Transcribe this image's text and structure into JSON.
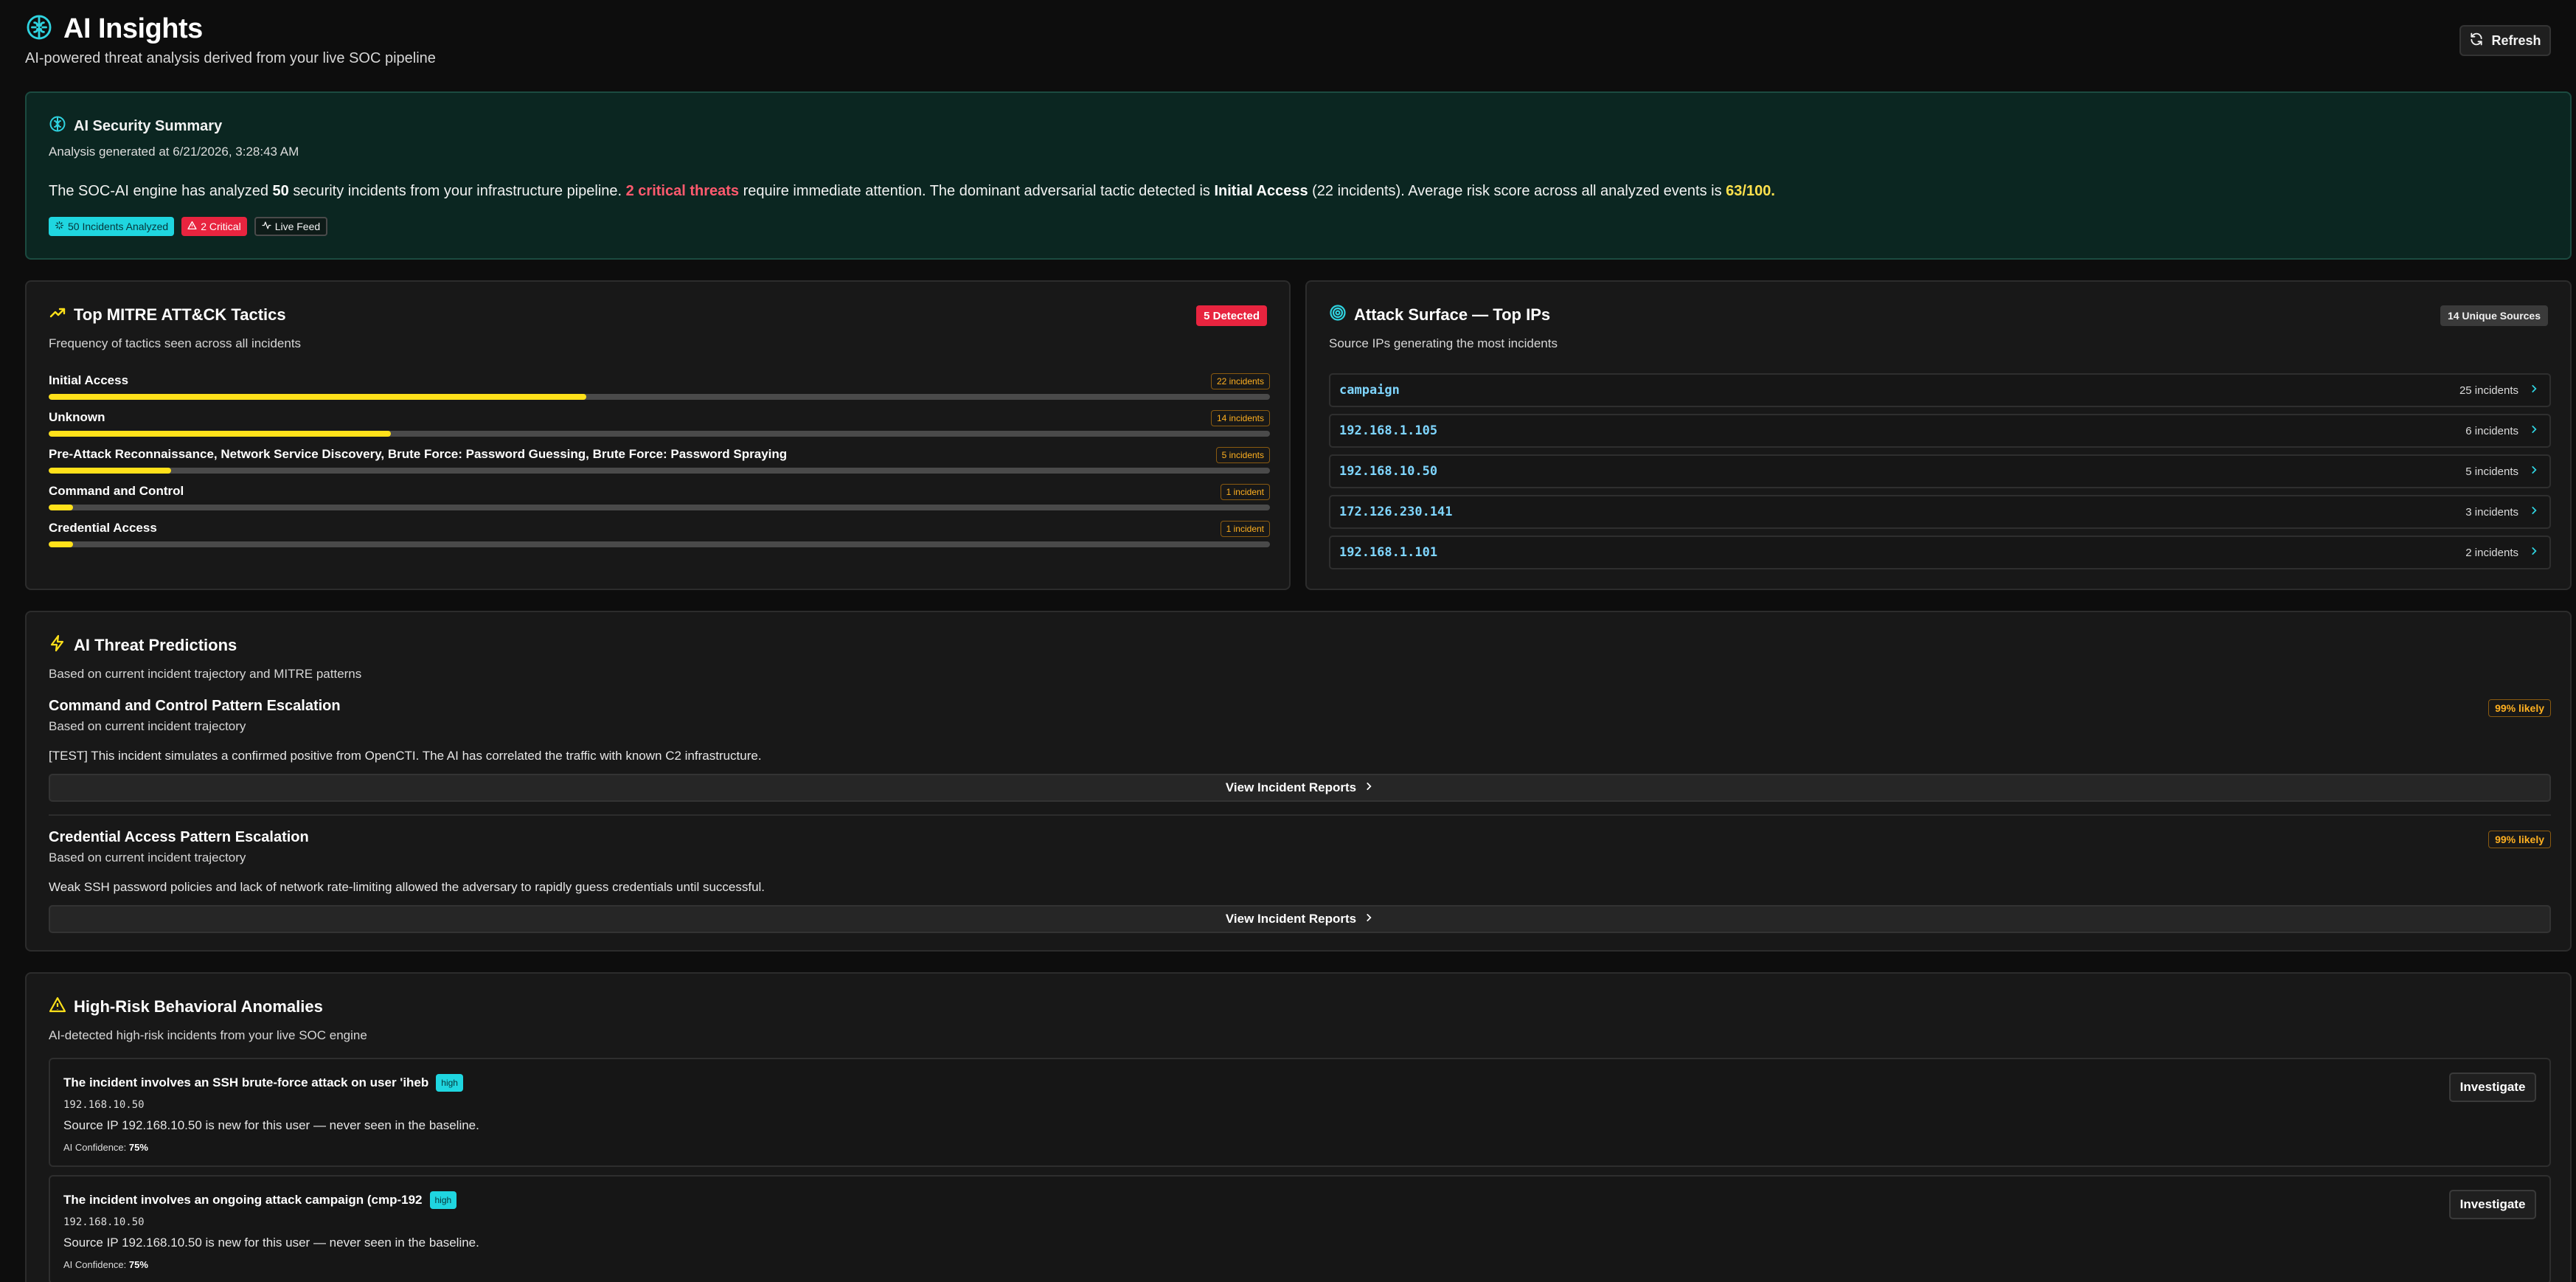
{
  "header": {
    "title": "AI Insights",
    "subtitle": "AI-powered threat analysis derived from your live SOC pipeline",
    "refresh_label": "Refresh"
  },
  "summary": {
    "title": "AI Security Summary",
    "generated": "Analysis generated at 6/21/2026, 3:28:43 AM",
    "text_1": "The SOC-AI engine has analyzed ",
    "incident_count": "50",
    "text_2": " security incidents from your infrastructure pipeline. ",
    "critical_text": "2 critical threats",
    "text_3": " require immediate attention. The dominant adversarial tactic detected is ",
    "dominant_tactic": "Initial Access",
    "text_4": " (22 incidents). Average risk score across all analyzed events is ",
    "risk_score": "63/100",
    "text_5": ".",
    "badges": {
      "analyzed": "50 Incidents Analyzed",
      "critical": "2 Critical",
      "live": "Live Feed"
    }
  },
  "tactics": {
    "title": "Top MITRE ATT&CK Tactics",
    "subtitle": "Frequency of tactics seen across all incidents",
    "count_badge": "5 Detected",
    "items": [
      {
        "name": "Initial Access",
        "count_label": "22 incidents",
        "count": 22
      },
      {
        "name": "Unknown",
        "count_label": "14 incidents",
        "count": 14
      },
      {
        "name": "Pre-Attack Reconnaissance, Network Service Discovery, Brute Force: Password Guessing, Brute Force: Password Spraying",
        "count_label": "5 incidents",
        "count": 5
      },
      {
        "name": "Command and Control",
        "count_label": "1 incident",
        "count": 1
      },
      {
        "name": "Credential Access",
        "count_label": "1 incident",
        "count": 1
      }
    ],
    "max_count": 50
  },
  "ips": {
    "title": "Attack Surface — Top IPs",
    "subtitle": "Source IPs generating the most incidents",
    "count_badge": "14 Unique Sources",
    "items": [
      {
        "addr": "campaign",
        "count": "25 incidents"
      },
      {
        "addr": "192.168.1.105",
        "count": "6 incidents"
      },
      {
        "addr": "192.168.10.50",
        "count": "5 incidents"
      },
      {
        "addr": "172.126.230.141",
        "count": "3 incidents"
      },
      {
        "addr": "192.168.1.101",
        "count": "2 incidents"
      }
    ]
  },
  "predictions": {
    "title": "AI Threat Predictions",
    "subtitle": "Based on current incident trajectory and MITRE patterns",
    "items": [
      {
        "title": "Command and Control Pattern Escalation",
        "sub": "Based on current incident trajectory",
        "desc": "[TEST] This incident simulates a confirmed positive from OpenCTI. The AI has correlated the traffic with known C2 infrastructure.",
        "likely": "99% likely",
        "button": "View Incident Reports"
      },
      {
        "title": "Credential Access Pattern Escalation",
        "sub": "Based on current incident trajectory",
        "desc": "Weak SSH password policies and lack of network rate-limiting allowed the adversary to rapidly guess credentials until successful.",
        "likely": "99% likely",
        "button": "View Incident Reports"
      }
    ]
  },
  "anomalies": {
    "title": "High-Risk Behavioral Anomalies",
    "subtitle": "AI-detected high-risk incidents from your live SOC engine",
    "items": [
      {
        "title": "The incident involves an SSH brute-force attack on user 'iheb",
        "severity": "high",
        "ip": "192.168.10.50",
        "desc": "Source IP 192.168.10.50 is new for this user — never seen in the baseline.",
        "conf_label": "AI Confidence: ",
        "conf_value": "75%",
        "button": "Investigate"
      },
      {
        "title": "The incident involves an ongoing attack campaign (cmp-192",
        "severity": "high",
        "ip": "192.168.10.50",
        "desc": "Source IP 192.168.10.50 is new for this user — never seen in the baseline.",
        "conf_label": "AI Confidence: ",
        "conf_value": "75%",
        "button": "Investigate"
      }
    ]
  },
  "colors": {
    "accent": "#1fd6e0",
    "critical": "#e8243f",
    "bar": "#ffe11a",
    "warning": "#ffb020"
  },
  "icons": {
    "header": "brain-icon",
    "refresh": "refresh-icon",
    "tactics": "trending-up-icon",
    "ips": "target-icon",
    "predictions": "lightning-icon",
    "anomalies": "warning-triangle-icon"
  }
}
